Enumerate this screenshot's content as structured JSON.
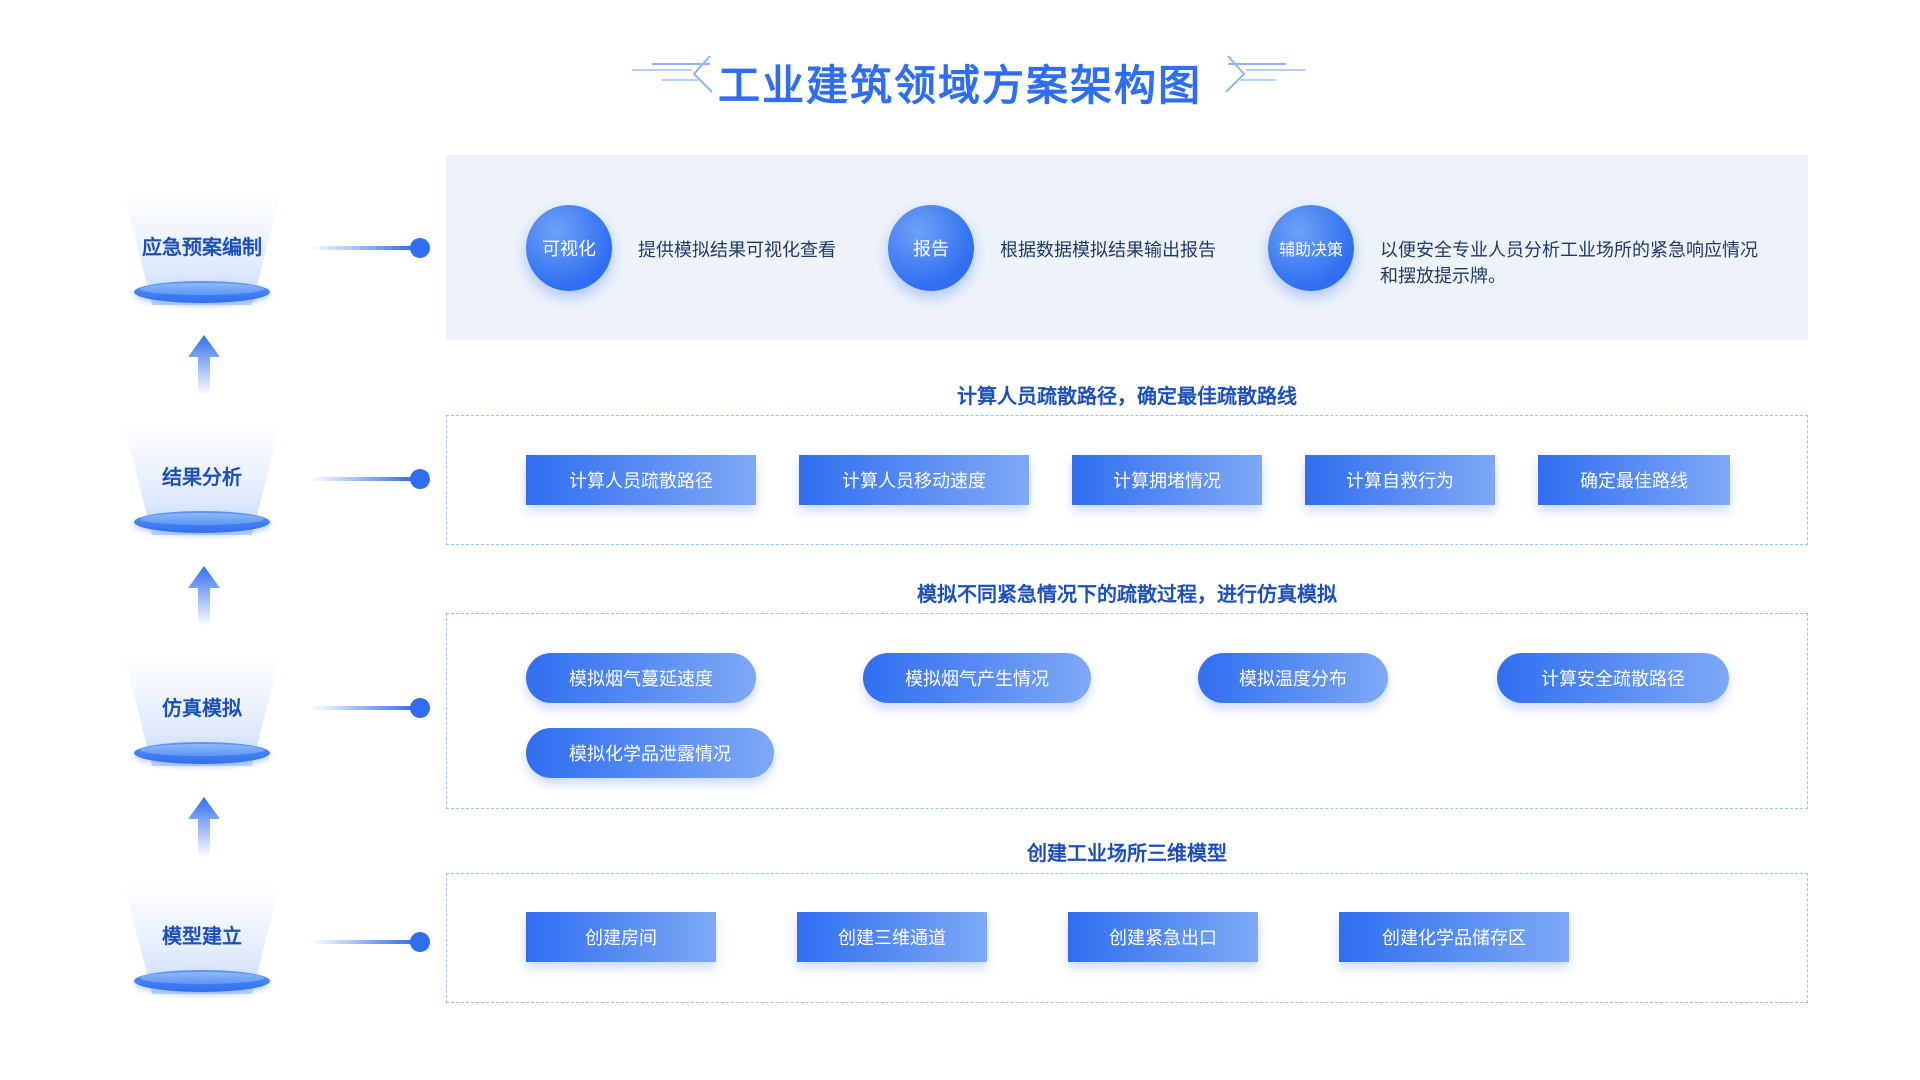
{
  "title": "工业建筑领域方案架构图",
  "colors": {
    "accent": "#2f6ef0",
    "panel_bg": "#eef3fb",
    "dashed_border": "#9fc0ef",
    "label": "#1d4fb8"
  },
  "stages": [
    {
      "label": "应急预案编制",
      "icon": "cone-pedestal"
    },
    {
      "label": "结果分析",
      "icon": "cone-pedestal"
    },
    {
      "label": "仿真模拟",
      "icon": "cone-pedestal"
    },
    {
      "label": "模型建立",
      "icon": "cone-pedestal"
    }
  ],
  "outputs": [
    {
      "circle": "可视化",
      "desc": "提供模拟结果可视化查看"
    },
    {
      "circle": "报告",
      "desc": "根据数据模拟结果输出报告"
    },
    {
      "circle": "辅助决策",
      "desc": "以便安全专业人员分析工业场所的紧急响应情况和摆放提示牌。"
    }
  ],
  "analysis": {
    "caption": "计算人员疏散路径，确定最佳疏散路线",
    "items": [
      "计算人员疏散路径",
      "计算人员移动速度",
      "计算拥堵情况",
      "计算自救行为",
      "确定最佳路线"
    ]
  },
  "simulation": {
    "caption": "模拟不同紧急情况下的疏散过程，进行仿真模拟",
    "items": [
      "模拟烟气蔓延速度",
      "模拟烟气产生情况",
      "模拟温度分布",
      "计算安全疏散路径",
      "模拟化学品泄露情况"
    ]
  },
  "modeling": {
    "caption": "创建工业场所三维模型",
    "items": [
      "创建房间",
      "创建三维通道",
      "创建紧急出口",
      "创建化学品储存区"
    ]
  }
}
